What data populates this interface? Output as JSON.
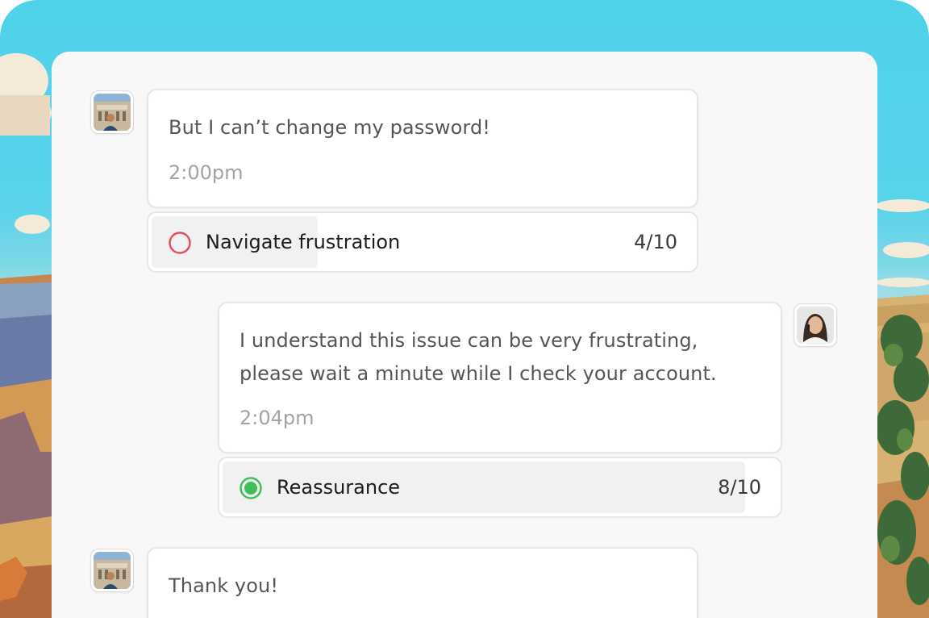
{
  "conversation": {
    "messages": [
      {
        "sender": "customer",
        "text": "But I can’t change my password!",
        "time": "2:00pm",
        "evaluation": {
          "label": "Navigate frustration",
          "score": "4/10",
          "fraction": 0.4,
          "status": "negative",
          "icon": "empty-circle-icon",
          "color": "#e8495b"
        }
      },
      {
        "sender": "agent",
        "text": "I understand this issue can be very frustrating,",
        "text_line2": "please wait a minute while I check your account.",
        "time": "2:04pm",
        "evaluation": {
          "label": "Reassurance",
          "score": "8/10",
          "fraction": 0.8,
          "status": "positive",
          "icon": "filled-circle-icon",
          "color": "#3fbf5a"
        }
      },
      {
        "sender": "customer",
        "text": "Thank you!"
      }
    ]
  },
  "colors": {
    "negative": "#e8495b",
    "positive": "#3fbf5a",
    "sky": "#55d2ea"
  }
}
